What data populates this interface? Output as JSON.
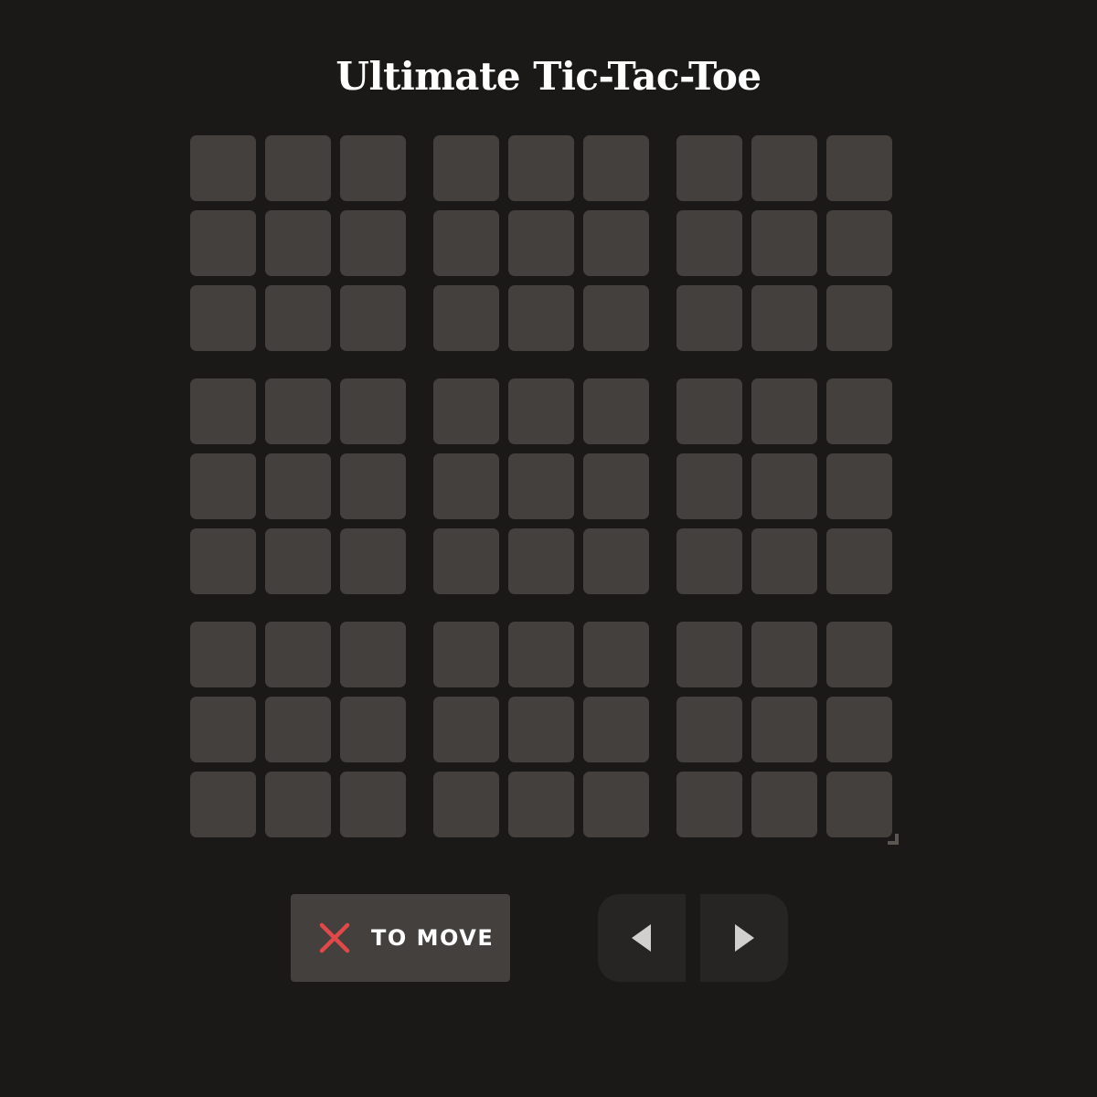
{
  "title": "Ultimate Tic-Tac-Toe",
  "status": {
    "player_icon": "x-icon",
    "player_color": "#e0484a",
    "text": "TO MOVE"
  },
  "navigation": {
    "prev_icon": "triangle-left-icon",
    "next_icon": "triangle-right-icon"
  },
  "board": {
    "sub_boards": 9,
    "cells_per_sub_board": 9,
    "cells": [
      [
        "",
        "",
        "",
        "",
        "",
        "",
        "",
        "",
        ""
      ],
      [
        "",
        "",
        "",
        "",
        "",
        "",
        "",
        "",
        ""
      ],
      [
        "",
        "",
        "",
        "",
        "",
        "",
        "",
        "",
        ""
      ],
      [
        "",
        "",
        "",
        "",
        "",
        "",
        "",
        "",
        ""
      ],
      [
        "",
        "",
        "",
        "",
        "",
        "",
        "",
        "",
        ""
      ],
      [
        "",
        "",
        "",
        "",
        "",
        "",
        "",
        "",
        ""
      ],
      [
        "",
        "",
        "",
        "",
        "",
        "",
        "",
        "",
        ""
      ],
      [
        "",
        "",
        "",
        "",
        "",
        "",
        "",
        "",
        ""
      ],
      [
        "",
        "",
        "",
        "",
        "",
        "",
        "",
        "",
        ""
      ]
    ]
  },
  "colors": {
    "background": "#1b1917",
    "cell": "#43403d",
    "nav_button": "#272523"
  }
}
